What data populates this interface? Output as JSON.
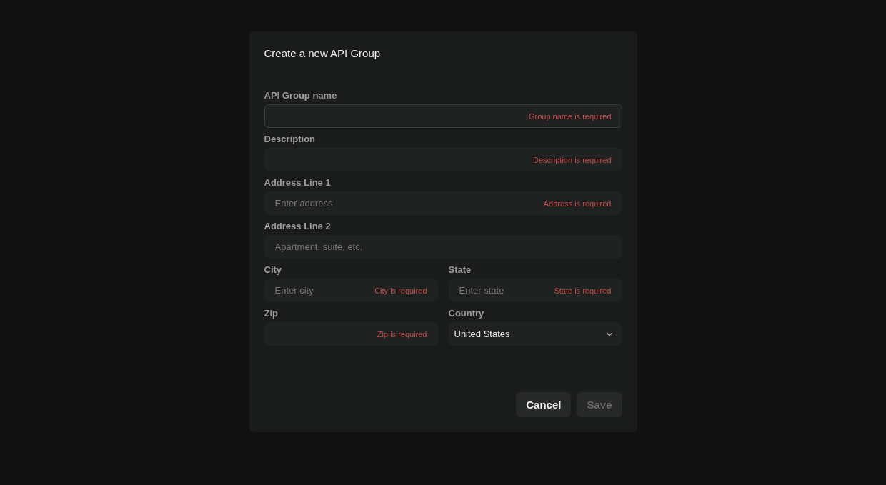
{
  "dialog": {
    "title": "Create a new API Group",
    "rows": [
      [
        {
          "kind": "text",
          "label": "API Group name",
          "error": "Group name is required",
          "focused": true
        }
      ],
      [
        {
          "kind": "text",
          "label": "Description",
          "error": "Description is required",
          "focused": false
        }
      ],
      [
        {
          "kind": "text",
          "label": "Address Line 1",
          "placeholder": "Enter address",
          "error": "Address is required",
          "focused": false
        }
      ],
      [
        {
          "kind": "text",
          "label": "Address Line 2",
          "placeholder": "Apartment, suite, etc.",
          "focused": false
        }
      ],
      [
        {
          "kind": "text",
          "label": "City",
          "placeholder": "Enter city",
          "error": "City is required",
          "focused": false
        },
        {
          "kind": "text",
          "label": "State",
          "placeholder": "Enter state",
          "error": "State is required",
          "focused": false
        }
      ],
      [
        {
          "kind": "text",
          "label": "Zip",
          "error": "Zip is required",
          "focused": false
        },
        {
          "kind": "select",
          "label": "Country",
          "value": "United States",
          "focused": false
        }
      ]
    ],
    "buttons": [
      {
        "label": "Cancel",
        "disabled": false
      },
      {
        "label": "Save",
        "disabled": true
      }
    ]
  }
}
